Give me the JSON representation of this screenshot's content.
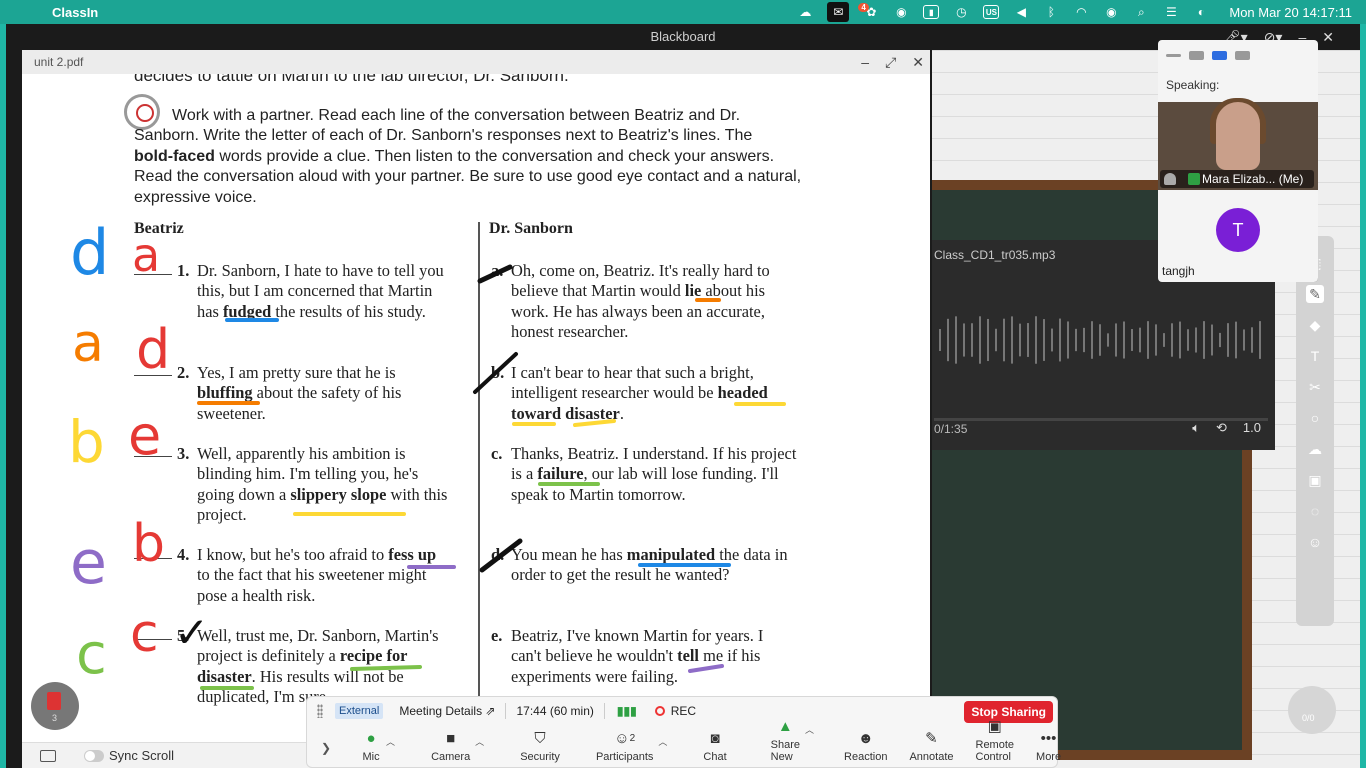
{
  "menubar": {
    "app_name": "ClassIn",
    "date_time": "Mon Mar 20  14:17:11",
    "badge": "4",
    "input_source": "US"
  },
  "window": {
    "title": "Blackboard"
  },
  "pdf": {
    "file_name": "unit 2.pdf",
    "top_cut_line": "decides to tattle on Martin to the lab director, Dr. Sanborn.",
    "instructions": {
      "line1": "Work with a partner. Read each line of the conversation between Beatriz and Dr.",
      "line2": "Sanborn. Write the letter of each of Dr. Sanborn's responses next to Beatriz's lines. The",
      "line3_bold": "bold-faced",
      "line3_rest": " words provide a clue. Then listen to the conversation and check your answers.",
      "line4": "Read the conversation aloud with your partner. Be sure to use good eye contact and a natural,",
      "line5": "expressive voice."
    },
    "col_left": "Beatriz",
    "col_right": "Dr. Sanborn",
    "beatriz": [
      {
        "num": "1.",
        "l1": "Dr. Sanborn, I hate to have to tell you",
        "l2": "this, but I am concerned that Martin",
        "l3a": "has ",
        "l3b": "fudged",
        "l3c": " the results of his study."
      },
      {
        "num": "2.",
        "l1": "Yes, I am pretty sure that he is",
        "l2b": "bluffing",
        "l2c": " about the safety of his",
        "l3": "sweetener."
      },
      {
        "num": "3.",
        "l1": "Well, apparently his ambition is",
        "l2": "blinding him. I'm telling you, he's",
        "l3a": "going down a ",
        "l3b": "slippery slope",
        "l3c": " with this",
        "l4": "project."
      },
      {
        "num": "4.",
        "l1a": "I know, but he's too afraid to ",
        "l1b": "fess up",
        "l2": "to the fact that his sweetener might",
        "l3": "pose a health risk."
      },
      {
        "num": "5.",
        "l1": "Well, trust me, Dr. Sanborn, Martin's",
        "l2a": "project is definitely a ",
        "l2b": "recipe for",
        "l3b": "disaster",
        "l3c": ". His results will not be",
        "l4": "duplicated, I'm sure."
      }
    ],
    "sanborn": [
      {
        "letter": "a.",
        "l1": "Oh, come on, Beatriz. It's really hard to",
        "l2a": "believe that Martin would ",
        "l2b": "lie",
        "l2c": " about his",
        "l3": "work. He has always been an accurate,",
        "l4": "honest researcher."
      },
      {
        "letter": "b.",
        "l1": "I can't bear to hear that such a bright,",
        "l2a": "intelligent researcher would be ",
        "l2b": "headed",
        "l3b": "toward disaster",
        "l3c": "."
      },
      {
        "letter": "c.",
        "l1": "Thanks, Beatriz. I understand. If his project",
        "l2a": "is a ",
        "l2b": "failure",
        "l2c": ", our lab will lose funding. I'll",
        "l3": "speak to Martin tomorrow."
      },
      {
        "letter": "d.",
        "l1a": "You mean he has ",
        "l1b": "manipulated",
        "l1c": " the data in",
        "l2": "order to get the result he wanted?"
      },
      {
        "letter": "e.",
        "l1": "Beatriz, I've known Martin for years. I",
        "l2a": "can't believe he wouldn't ",
        "l2b": "tell",
        "l2c": " me if his",
        "l3": "experiments were failing."
      }
    ],
    "handwritten": {
      "left_letters": [
        "d",
        "a",
        "b",
        "e",
        "c"
      ],
      "blank_letters": [
        "a",
        "d",
        "e",
        "b",
        "c"
      ],
      "check": "✓"
    },
    "footer": {
      "sync_label": "Sync Scroll"
    },
    "fab_count": "3"
  },
  "audio": {
    "file_name": "Class_CD1_tr035.mp3",
    "time": "0/1:35",
    "speed": "1.0"
  },
  "video_panel": {
    "speaking_label": "Speaking:",
    "participant1": "Mara Elizab... (Me)",
    "participant2_initial": "T",
    "participant2": "tangjh"
  },
  "right_fab_count": "0/0",
  "zoom": {
    "external_label": "External",
    "meeting_details": "Meeting Details",
    "time": "17:44",
    "duration": "(60 min)",
    "rec_label": "REC",
    "stop_sharing": "Stop Sharing",
    "participants_count": "2",
    "buttons": {
      "mic": "Mic",
      "camera": "Camera",
      "security": "Security",
      "participants": "Participants",
      "chat": "Chat",
      "share_new": "Share New",
      "reaction": "Reaction",
      "annotate": "Annotate",
      "remote_control": "Remote Control",
      "more": "More"
    }
  },
  "colors": {
    "menubar": "#1ca594",
    "annotation_blue": "#1e88e5",
    "annotation_red": "#e53935",
    "annotation_orange": "#f57c00",
    "annotation_yellow": "#fdd835",
    "annotation_purple": "#8e6cc7",
    "annotation_green": "#7cc24a",
    "stop_red": "#e0242e"
  }
}
